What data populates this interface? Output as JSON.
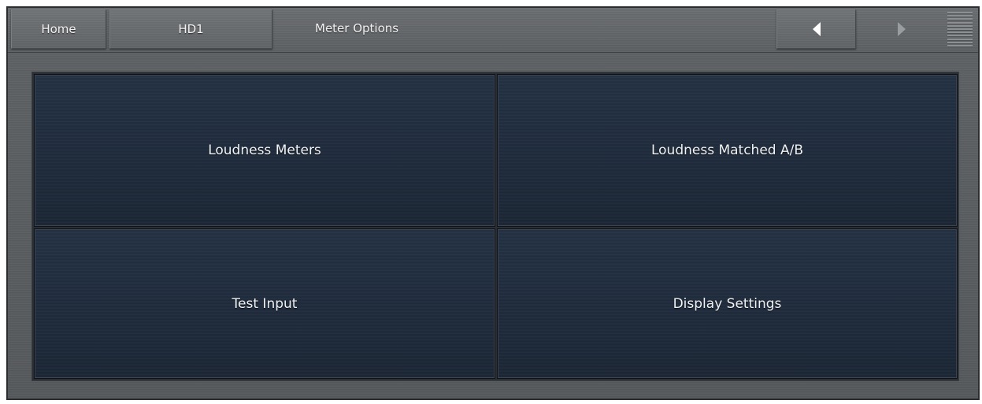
{
  "nav": {
    "home_label": "Home",
    "hd1_label": "HD1",
    "page_title": "Meter Options"
  },
  "icons": {
    "back": "triangle-left-icon",
    "forward": "triangle-right-icon",
    "menu": "hamburger-menu-icon"
  },
  "colors": {
    "tile_bg": "#1e2a3a",
    "frame_bg": "#5a5d60",
    "text": "#f0f2f4"
  },
  "tiles": [
    {
      "label": "Loudness Meters"
    },
    {
      "label": "Loudness Matched A/B"
    },
    {
      "label": "Test Input"
    },
    {
      "label": "Display Settings"
    }
  ]
}
